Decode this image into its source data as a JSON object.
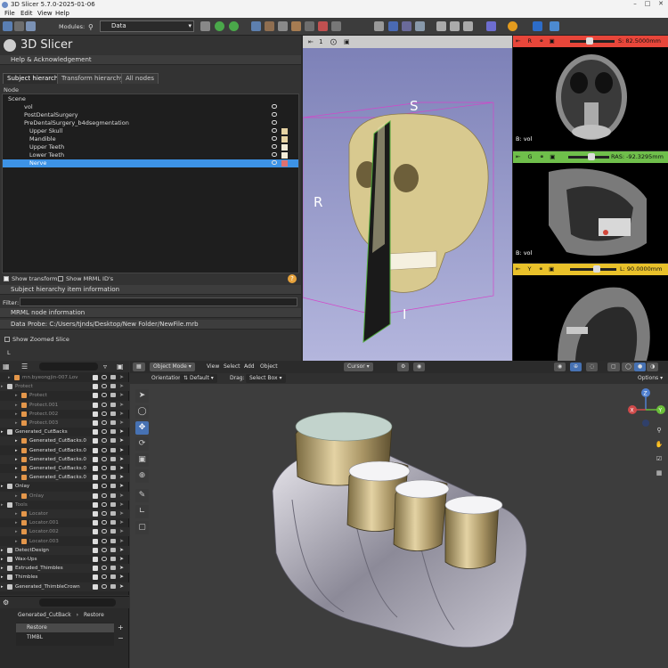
{
  "slicer": {
    "window_title": "3D Slicer 5.7.0-2025-01-06",
    "menu": [
      "File",
      "Edit",
      "View",
      "Help"
    ],
    "modules_label": "Modules:",
    "module_value": "Data",
    "app_title": "3D Slicer",
    "help_section": "Help & Acknowledgement",
    "tabs": [
      "Subject hierarchy",
      "Transform hierarchy",
      "All nodes"
    ],
    "tree_header": "Node",
    "tree": [
      {
        "label": "Scene",
        "indent": 0
      },
      {
        "label": "vol",
        "indent": 1
      },
      {
        "label": "PostDentalSurgery",
        "indent": 1
      },
      {
        "label": "PreDentalSurgery_b4dsegmentation",
        "indent": 1
      },
      {
        "label": "Upper Skull",
        "indent": 2,
        "color": "#e6d3a3"
      },
      {
        "label": "Mandible",
        "indent": 2,
        "color": "#e6d3a3"
      },
      {
        "label": "Upper Teeth",
        "indent": 2,
        "color": "#f3ecd8"
      },
      {
        "label": "Lower Teeth",
        "indent": 2,
        "color": "#f3ecd8"
      },
      {
        "label": "Nerve",
        "indent": 2,
        "color": "#e07070",
        "selected": true
      }
    ],
    "show_transforms": "Show transforms",
    "show_ids": "Show MRML ID's",
    "sh_info": "Subject hierarchy item information",
    "filter_label": "Filter:",
    "mrml_info": "MRML node information",
    "data_probe": "Data Probe: C:/Users/tjnds/Desktop/New Folder/NewFile.mrb",
    "show_zoomed": "Show Zoomed Slice",
    "probe_l": "L",
    "view3d": {
      "viewer_id": "1",
      "label_s": "S",
      "label_r": "R",
      "label_i": "I"
    },
    "red": {
      "letter": "R",
      "offset": "S: 82.5000mm",
      "layer": "B: vol",
      "color": "#e8463a"
    },
    "green": {
      "letter": "G",
      "offset": "RAS: -92.3295mm",
      "layer": "B: vol",
      "color": "#6fbf4b"
    },
    "yellow": {
      "letter": "Y",
      "offset": "L: 90.0000mm",
      "color": "#e9c12a"
    }
  },
  "blender": {
    "outliner": [
      {
        "label": "mn.byeongjin-007.Lov",
        "indent": 1,
        "dim": true
      },
      {
        "label": "Protect",
        "indent": 0,
        "dim": true
      },
      {
        "label": "Protect",
        "indent": 2,
        "dim": true
      },
      {
        "label": "Protect.001",
        "indent": 2,
        "dim": true
      },
      {
        "label": "Protect.002",
        "indent": 2,
        "dim": true
      },
      {
        "label": "Protect.003",
        "indent": 2,
        "dim": true
      },
      {
        "label": "Generated_CutBacks",
        "indent": 0
      },
      {
        "label": "Generated_CutBacks.0",
        "indent": 2
      },
      {
        "label": "Generated_CutBacks.0",
        "indent": 2
      },
      {
        "label": "Generated_CutBacks.0",
        "indent": 2
      },
      {
        "label": "Generated_CutBacks.0",
        "indent": 2
      },
      {
        "label": "Generated_CutBacks.0",
        "indent": 2
      },
      {
        "label": "Onlay",
        "indent": 0
      },
      {
        "label": "Onlay",
        "indent": 2,
        "dim": true
      },
      {
        "label": "Tools",
        "indent": 0,
        "dim": true
      },
      {
        "label": "Locator",
        "indent": 2,
        "dim": true
      },
      {
        "label": "Locator.001",
        "indent": 2,
        "dim": true
      },
      {
        "label": "Locator.002",
        "indent": 2,
        "dim": true
      },
      {
        "label": "Locator.003",
        "indent": 2,
        "dim": true
      },
      {
        "label": "DetectDesign",
        "indent": 0
      },
      {
        "label": "Wax-Ups",
        "indent": 0
      },
      {
        "label": "Extruded_Thimbles",
        "indent": 0
      },
      {
        "label": "Thimbles",
        "indent": 0
      },
      {
        "label": "Generated_ThimbleCrown",
        "indent": 0
      }
    ],
    "props_path": "Generated_CutBack",
    "props_target": "Restore",
    "props_items": [
      "Restore",
      "TIMBL"
    ],
    "mode": "Object Mode",
    "menus": [
      "View",
      "Select",
      "Add",
      "Object"
    ],
    "orientation_label": "Orientation:",
    "orientation_value": "Default",
    "drag_label": "Drag:",
    "drag_value": "Select Box",
    "pivot": "Cursor",
    "options": "Options",
    "gizmo": {
      "z": "Z",
      "y": "Y",
      "x": "X"
    }
  },
  "colors": {
    "selection": "#3d93e6",
    "blender_active": "#4772b3",
    "slicer_red": "#e8463a",
    "slicer_green": "#6fbf4b",
    "slicer_yellow": "#e9c12a"
  }
}
